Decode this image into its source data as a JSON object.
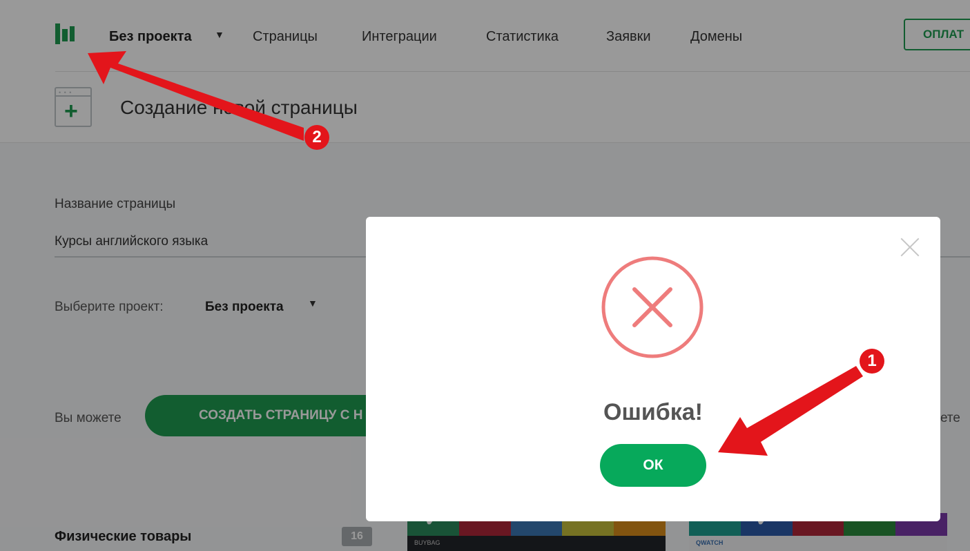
{
  "nav": {
    "project": "Без проекта",
    "items": [
      "Страницы",
      "Интеграции",
      "Статистика",
      "Заявки",
      "Домены"
    ],
    "pay_button": "ОПЛАТ"
  },
  "header": {
    "title": "Создание новой страницы"
  },
  "form": {
    "name_label": "Название страницы",
    "name_value": "Курсы английского языка",
    "project_label": "Выберите проект:",
    "project_value": "Без проекта"
  },
  "actions": {
    "intro_text": "Вы можете",
    "create_button": "СОЗДАТЬ СТРАНИЦУ С Н",
    "right_fragment": "ете"
  },
  "category": {
    "title": "Физические товары",
    "count": "16",
    "thumbs": [
      {
        "name": "BUYBAG",
        "colors": [
          "#2b8a5c",
          "#b0273a",
          "#3b77b5",
          "#c5bf3b",
          "#d98c1c"
        ]
      },
      {
        "name": "QWATCH",
        "colors": [
          "#1d9e8f",
          "#2c5aa8",
          "#b0273a",
          "#2b8a3c",
          "#7b3aa8"
        ]
      }
    ]
  },
  "modal": {
    "title": "Ошибка!",
    "ok_button": "ОК"
  },
  "annotations": {
    "badge_1": "1",
    "badge_2": "2",
    "arrow_color": "#e3151b"
  },
  "colors": {
    "brand_green": "#1e9c50",
    "ok_green": "#07a95b",
    "error_red": "#ee7c7c"
  }
}
